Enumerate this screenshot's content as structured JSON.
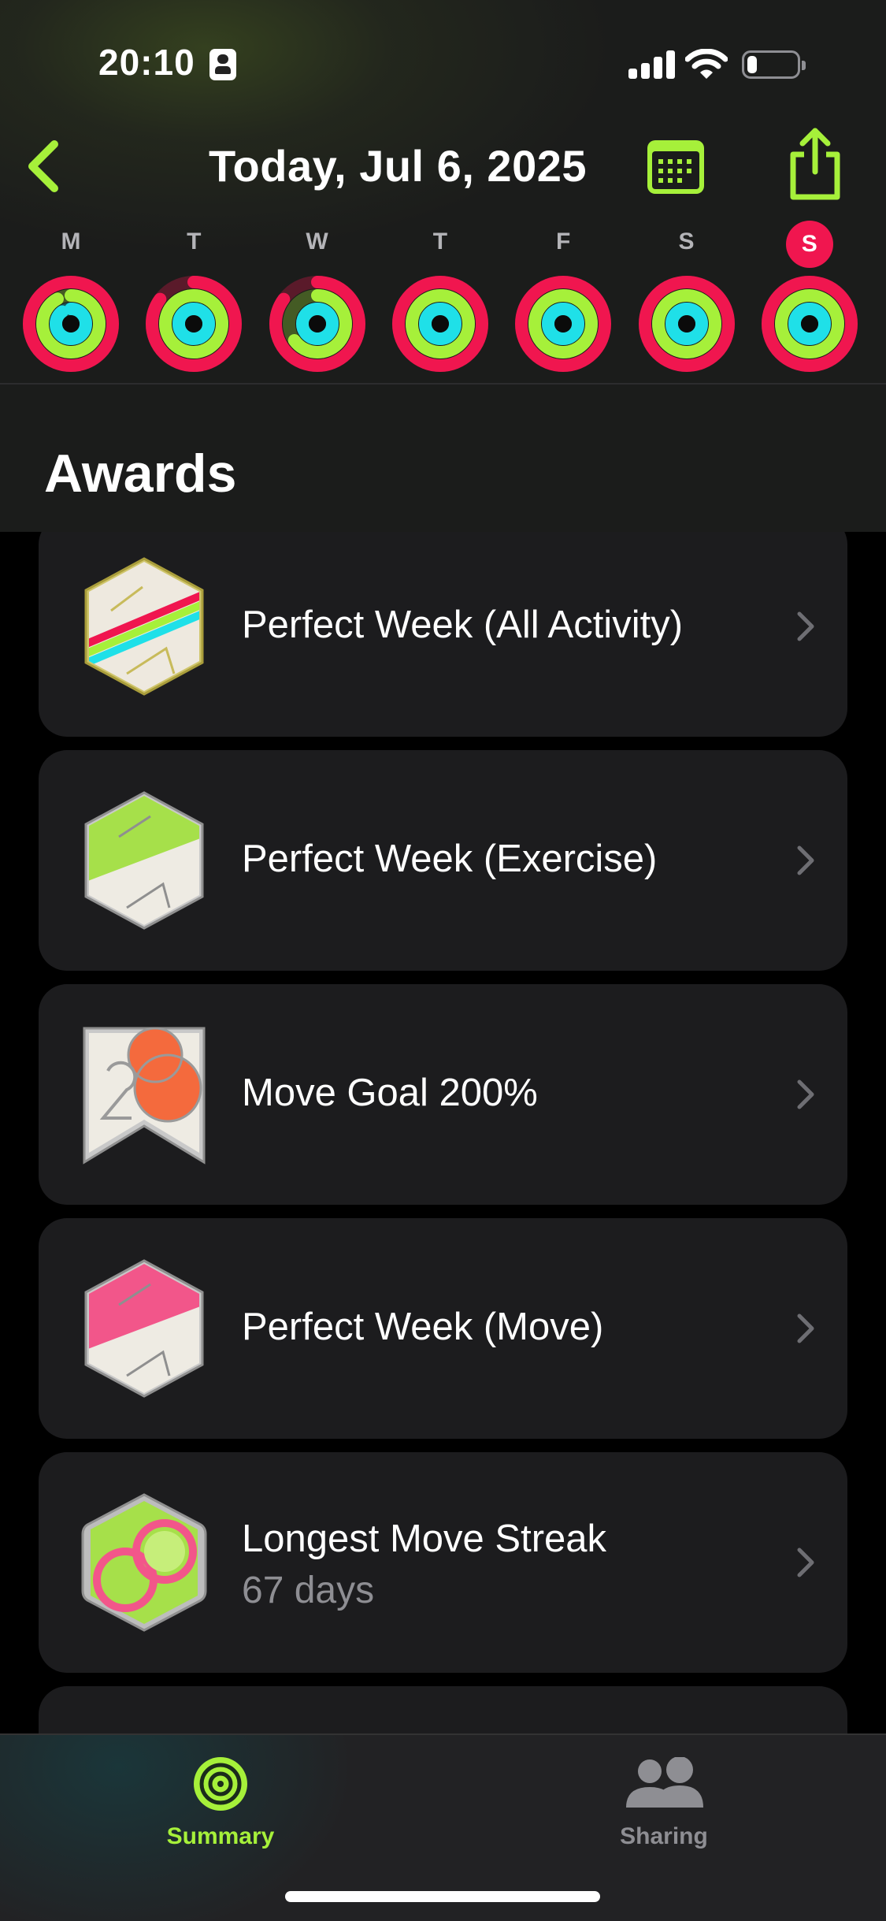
{
  "status_bar": {
    "time": "20:10",
    "battery_level": 0.12
  },
  "nav": {
    "title": "Today, Jul 6, 2025",
    "back_icon": "chevron-left-icon",
    "calendar_icon": "calendar-icon",
    "share_icon": "share-icon"
  },
  "week": {
    "days": [
      {
        "label": "M",
        "move": 1.0,
        "exercise": 0.92,
        "stand": 0.9
      },
      {
        "label": "T",
        "move": 0.85,
        "exercise": 1.0,
        "stand": 1.0
      },
      {
        "label": "W",
        "move": 0.85,
        "exercise": 0.65,
        "stand": 1.0
      },
      {
        "label": "T",
        "move": 1.0,
        "exercise": 1.0,
        "stand": 1.0
      },
      {
        "label": "F",
        "move": 1.0,
        "exercise": 1.0,
        "stand": 1.0
      },
      {
        "label": "S",
        "move": 1.0,
        "exercise": 1.0,
        "stand": 1.0
      },
      {
        "label": "S",
        "move": 1.0,
        "exercise": 1.0,
        "stand": 1.0,
        "today": true
      }
    ]
  },
  "awards": {
    "title": "Awards",
    "items": [
      {
        "title": "Perfect Week (All Activity)",
        "badge": "perfect-week-all-badge"
      },
      {
        "title": "Perfect Week (Exercise)",
        "badge": "perfect-week-exercise-badge"
      },
      {
        "title": "Move Goal 200%",
        "badge": "move-goal-200-badge"
      },
      {
        "title": "Perfect Week (Move)",
        "badge": "perfect-week-move-badge"
      },
      {
        "title": "Longest Move Streak",
        "subtitle": "67 days",
        "badge": "longest-move-streak-badge"
      }
    ]
  },
  "tabbar": {
    "tabs": [
      {
        "label": "Summary",
        "icon": "summary-rings-icon",
        "selected": true
      },
      {
        "label": "Sharing",
        "icon": "sharing-people-icon",
        "selected": false
      }
    ]
  },
  "colors": {
    "accent": "#a6f03a",
    "move": "#f0164f",
    "exercise": "#a6f03a",
    "stand": "#1fe0e8",
    "card": "#1c1c1e",
    "secondary_text": "#8e8e93"
  }
}
